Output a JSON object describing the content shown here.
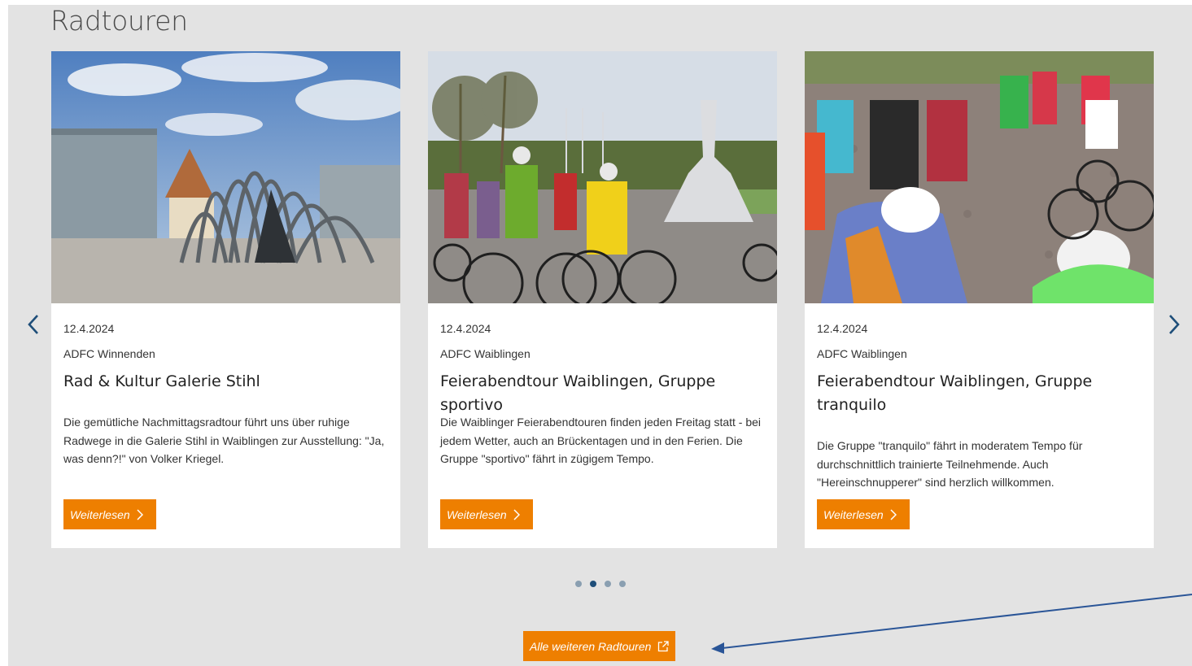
{
  "section": {
    "title": "Radtouren"
  },
  "carousel": {
    "prev_icon": "chevron-left-icon",
    "next_icon": "chevron-right-icon",
    "dot_count": 4,
    "active_dot": 2
  },
  "cards": [
    {
      "date": "12.4.2024",
      "org": "ADFC Winnenden",
      "title": "Rad & Kultur Galerie Stihl",
      "description": "Die gemütliche Nachmittagsradtour führt uns über ruhige Radwege in die Galerie Stihl in Waiblingen zur Ausstellung: \"Ja, was denn?!\" von Volker Kriegel.",
      "button": "Weiterlesen"
    },
    {
      "date": "12.4.2024",
      "org": "ADFC Waiblingen",
      "title": "Feierabendtour Waiblingen, Gruppe sportivo",
      "description": "Die Waiblinger Feierabendtouren finden jeden Freitag statt - bei jedem Wetter, auch an Brückentagen und in den Ferien. Die Gruppe \"sportivo\" fährt in zügigem Tempo.",
      "button": "Weiterlesen"
    },
    {
      "date": "12.4.2024",
      "org": "ADFC Waiblingen",
      "title": "Feierabendtour Waiblingen, Gruppe tranquilo",
      "description": "Die Gruppe \"tranquilo\" fährt in moderatem Tempo für durchschnittlich trainierte Teilnehmende. Auch \"Hereinschnupperer\" sind herzlich willkommen.",
      "button": "Weiterlesen"
    }
  ],
  "footer": {
    "all_button": "Alle weiteren Radtouren",
    "all_button_icon": "external-link-icon"
  },
  "colors": {
    "accent": "#ee7f00",
    "nav": "#1e4e79",
    "background": "#e3e3e3",
    "annotation_arrow": "#2a5597"
  }
}
